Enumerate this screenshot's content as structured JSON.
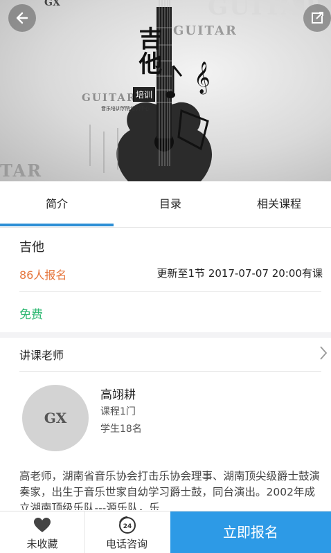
{
  "hero": {
    "title": "吉他",
    "badge": "培训",
    "subtitle": "音乐培训学院培训中心",
    "watermark_words": [
      "GUITAR",
      "GUITAR",
      "TAR",
      "GUITAR"
    ],
    "logo": "GX"
  },
  "tabs": [
    {
      "label": "简介",
      "active": true
    },
    {
      "label": "目录",
      "active": false
    },
    {
      "label": "相关课程",
      "active": false
    }
  ],
  "course": {
    "title": "吉他",
    "enroll_text": "86人报名",
    "update_text": "更新至1节 2017-07-07 20:00有课",
    "price": "免费"
  },
  "teacher_section": {
    "label": "讲课老师"
  },
  "teacher": {
    "avatar_text": "GX",
    "name": "高翊耕",
    "courses": "课程1门",
    "students": "学生18名",
    "bio": "高老师，湖南省音乐协会打击乐协会理事、湖南顶尖级爵士鼓演奏家，出生于音乐世家自幼学习爵士鼓，同台演出。2002年成立湖南顶级乐队---源乐队，乐"
  },
  "bottom_bar": {
    "favorite_label": "未收藏",
    "call_label": "电话咨询",
    "signup_label": "立即报名"
  },
  "colors": {
    "accent": "#2d8fd5",
    "enroll": "#e6763d",
    "price": "#2eb872",
    "signup_bg": "#2d9ae6"
  }
}
